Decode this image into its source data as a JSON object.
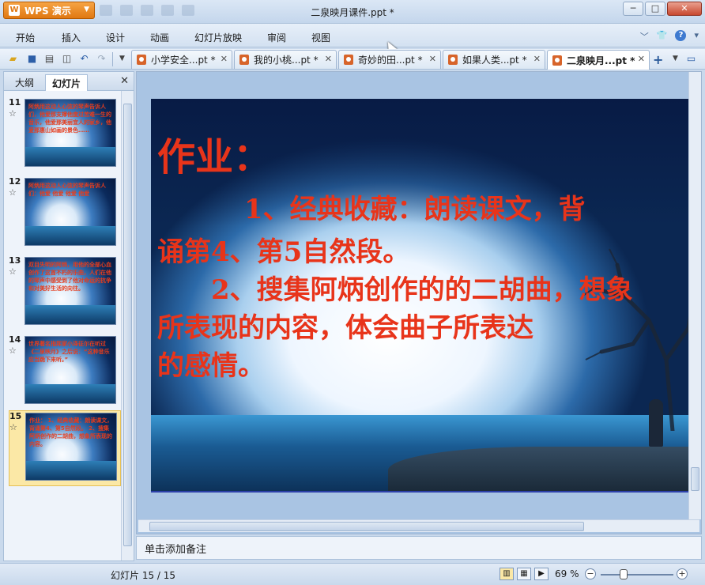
{
  "window": {
    "app_button_label": "WPS 演示",
    "title": "二泉映月课件.ppt *",
    "minimize": "─",
    "maximize": "□",
    "close": "✕"
  },
  "menu": [
    "开始",
    "插入",
    "设计",
    "动画",
    "幻灯片放映",
    "审阅",
    "视图"
  ],
  "document_tabs": [
    {
      "label": "小学安全...pt *",
      "active": false
    },
    {
      "label": "我的小桃...pt *",
      "active": false
    },
    {
      "label": "奇妙的田...pt *",
      "active": false
    },
    {
      "label": "如果人类...pt *",
      "active": false
    },
    {
      "label": "二泉映月...pt *",
      "active": true
    }
  ],
  "left_panel": {
    "tabs": [
      "大纲",
      "幻灯片"
    ],
    "active_tab": "幻灯片",
    "thumbnails": [
      {
        "number": "11",
        "text": "阿炳用这动人心弦的琴声告诉人们，他爱那支撑他度过苦难一生的音乐，他爱那美丽宜人的家乡，他爱那惠山如画的景色……"
      },
      {
        "number": "12",
        "text": "阿炳用这动人心弦的琴声告诉人们：他爱 他爱 他爱 他爱"
      },
      {
        "number": "13",
        "text": "双目失明的阿炳，用他的全部心血创作了这首不朽的乐曲，人们在他的琴声中感受到了他对命运的抗争和对美好生活的向往。"
      },
      {
        "number": "14",
        "text": "世界著名指挥家小泽征尔在听过《二泉映月》之后说：“这种音乐应当跪下来听。”"
      },
      {
        "number": "15",
        "text": "作业： 1、经典收藏：朗读课文，背诵第4、第5自然段。 2、搜集阿炳创作的二胡曲，想象所表现的内容。",
        "selected": true
      }
    ]
  },
  "slide": {
    "heading": "作业：",
    "lines": [
      "1、经典收藏：朗读课文，背",
      "诵第4、第5自然段。",
      "2、搜集阿炳创作的的二胡曲，想象",
      "所表现的内容，体会曲子所表达",
      "的感情。"
    ]
  },
  "notes_placeholder": "单击添加备注",
  "status": {
    "slide_counter": "幻灯片 15 / 15",
    "zoom": "69 %"
  }
}
